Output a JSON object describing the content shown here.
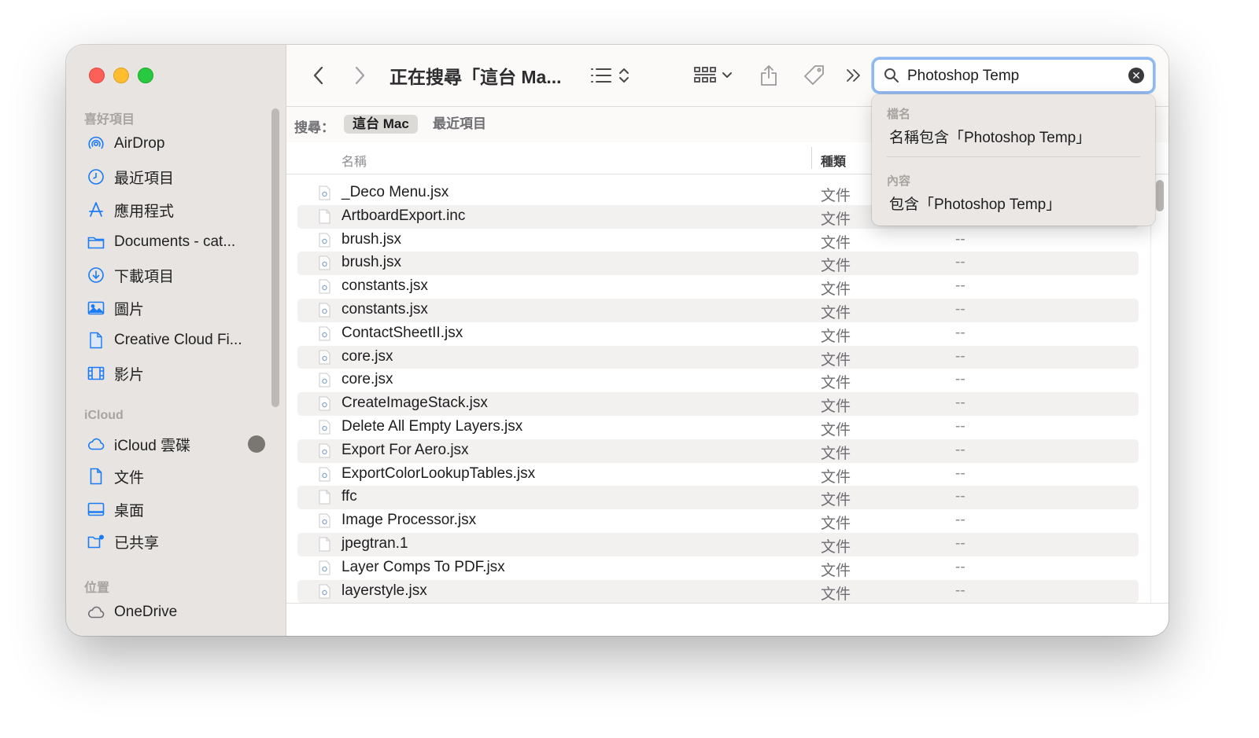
{
  "window": {
    "title": "正在搜尋「這台 Ma..."
  },
  "sidebar": {
    "sections": [
      {
        "title": "喜好項目",
        "items": [
          {
            "label": "AirDrop",
            "icon": "airdrop-icon"
          },
          {
            "label": "最近項目",
            "icon": "clock-icon"
          },
          {
            "label": "應用程式",
            "icon": "applications-icon"
          },
          {
            "label": "Documents - cat...",
            "icon": "folder-icon"
          },
          {
            "label": "下載項目",
            "icon": "download-icon"
          },
          {
            "label": "圖片",
            "icon": "photo-icon"
          },
          {
            "label": "Creative Cloud Fi...",
            "icon": "document-icon"
          },
          {
            "label": "影片",
            "icon": "film-icon"
          }
        ]
      },
      {
        "title": "iCloud",
        "items": [
          {
            "label": "iCloud 雲碟",
            "icon": "cloud-icon"
          },
          {
            "label": "文件",
            "icon": "document-icon"
          },
          {
            "label": "桌面",
            "icon": "desktop-icon"
          },
          {
            "label": "已共享",
            "icon": "shared-folder-icon"
          }
        ]
      },
      {
        "title": "位置",
        "items": [
          {
            "label": "OneDrive",
            "icon": "cloud-icon"
          }
        ]
      }
    ]
  },
  "search": {
    "value": "Photoshop Temp",
    "scope_label": "搜尋：",
    "scopes": [
      {
        "label": "這台 Mac",
        "active": true
      },
      {
        "label": "最近項目",
        "active": false
      }
    ],
    "suggestions": {
      "filename_section": "檔名",
      "filename_item": "名稱包含「Photoshop Temp」",
      "content_section": "內容",
      "content_item": "包含「Photoshop Temp」"
    }
  },
  "list": {
    "columns": {
      "name": "名稱",
      "kind": "種類"
    },
    "rows": [
      {
        "name": "_Deco Menu.jsx",
        "kind": "文件",
        "size": "",
        "type": "jsx"
      },
      {
        "name": "ArtboardExport.inc",
        "kind": "文件",
        "size": "",
        "type": "plain"
      },
      {
        "name": "brush.jsx",
        "kind": "文件",
        "size": "--",
        "type": "jsx"
      },
      {
        "name": "brush.jsx",
        "kind": "文件",
        "size": "--",
        "type": "jsx"
      },
      {
        "name": "constants.jsx",
        "kind": "文件",
        "size": "--",
        "type": "jsx"
      },
      {
        "name": "constants.jsx",
        "kind": "文件",
        "size": "--",
        "type": "jsx"
      },
      {
        "name": "ContactSheetII.jsx",
        "kind": "文件",
        "size": "--",
        "type": "jsx"
      },
      {
        "name": "core.jsx",
        "kind": "文件",
        "size": "--",
        "type": "jsx"
      },
      {
        "name": "core.jsx",
        "kind": "文件",
        "size": "--",
        "type": "jsx"
      },
      {
        "name": "CreateImageStack.jsx",
        "kind": "文件",
        "size": "--",
        "type": "jsx"
      },
      {
        "name": "Delete All Empty Layers.jsx",
        "kind": "文件",
        "size": "--",
        "type": "jsx"
      },
      {
        "name": "Export For Aero.jsx",
        "kind": "文件",
        "size": "--",
        "type": "jsx"
      },
      {
        "name": "ExportColorLookupTables.jsx",
        "kind": "文件",
        "size": "--",
        "type": "jsx"
      },
      {
        "name": "ffc",
        "kind": "文件",
        "size": "--",
        "type": "plain"
      },
      {
        "name": "Image Processor.jsx",
        "kind": "文件",
        "size": "--",
        "type": "jsx"
      },
      {
        "name": "jpegtran.1",
        "kind": "文件",
        "size": "--",
        "type": "plain"
      },
      {
        "name": "Layer Comps To PDF.jsx",
        "kind": "文件",
        "size": "--",
        "type": "jsx"
      },
      {
        "name": "layerstyle.jsx",
        "kind": "文件",
        "size": "--",
        "type": "jsx"
      }
    ]
  },
  "colors": {
    "sidebar_bg": "#e8e4e1",
    "accent": "#1a7cf5",
    "close": "#fe5f57",
    "minimize": "#febc2e",
    "maximize": "#28c840"
  }
}
